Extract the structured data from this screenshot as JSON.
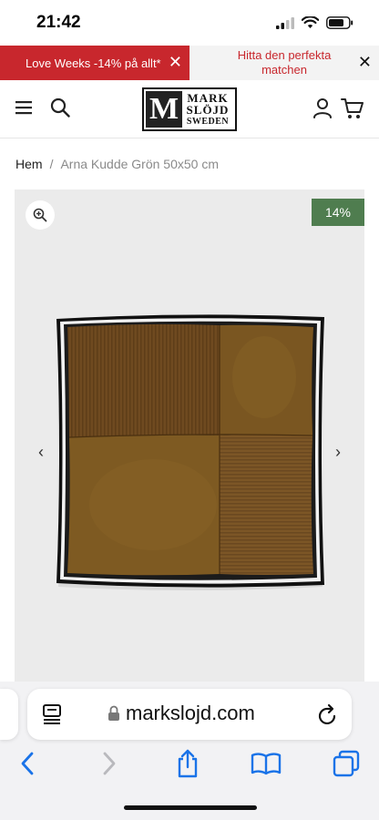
{
  "status_bar": {
    "time": "21:42"
  },
  "promo": {
    "left_text": "Love Weeks -14% på allt*",
    "right_text": "Hitta den perfekta matchen",
    "close_glyph": "✕",
    "left_bg": "#c8272d"
  },
  "header": {
    "logo": {
      "letter": "M",
      "line1": "MARK",
      "line2": "SLÖJD",
      "line3": "SWEDEN"
    }
  },
  "breadcrumb": {
    "home": "Hem",
    "separator": "/",
    "current": "Arna Kudde Grön 50x50 cm"
  },
  "gallery": {
    "discount_badge": "14%",
    "badge_color": "#4f7d4f",
    "prev_glyph": "‹",
    "next_glyph": "›"
  },
  "browser": {
    "url": "markslojd.com"
  },
  "icons": {
    "menu": "hamburger-icon",
    "search": "search-icon",
    "account": "user-icon",
    "cart": "cart-icon",
    "zoom": "zoom-in-icon",
    "reader": "reader-icon",
    "lock": "lock-icon",
    "reload": "reload-icon",
    "back": "back-icon",
    "forward": "forward-icon",
    "share": "share-icon",
    "bookmarks": "bookmarks-icon",
    "tabs": "tabs-icon"
  },
  "colors": {
    "accent_red": "#c8272d",
    "safari_blue": "#1a73e8"
  }
}
